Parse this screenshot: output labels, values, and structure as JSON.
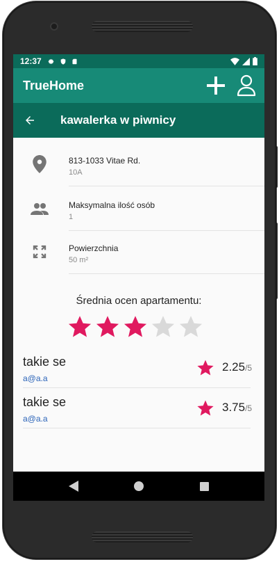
{
  "statusbar": {
    "time": "12:37"
  },
  "appbar": {
    "title": "TrueHome"
  },
  "subbar": {
    "title": "kawalerka w piwnicy"
  },
  "details": [
    {
      "icon": "location-pin-icon",
      "label": "813-1033 Vitae Rd.",
      "value": "10A"
    },
    {
      "icon": "people-icon",
      "label": "Maksymalna ilość osób",
      "value": "1"
    },
    {
      "icon": "expand-icon",
      "label": "Powierzchnia",
      "value": "50 m²"
    }
  ],
  "rating": {
    "title": "Średnia ocen apartamentu:",
    "stars_filled": 3,
    "stars_total": 5,
    "colors": {
      "filled": "#e0195f",
      "empty": "#d9d9d9"
    }
  },
  "reviews": [
    {
      "name": "takie se",
      "email": "a@a.a",
      "score": "2.25",
      "out_of": "/5"
    },
    {
      "name": "takie se",
      "email": "a@a.a",
      "score": "3.75",
      "out_of": "/5"
    }
  ],
  "colors": {
    "appbar": "#178a77",
    "statusbar": "#0b6b5a",
    "subbar": "#0b6b5a",
    "accent_star": "#e0195f",
    "link": "#2a63b8"
  }
}
